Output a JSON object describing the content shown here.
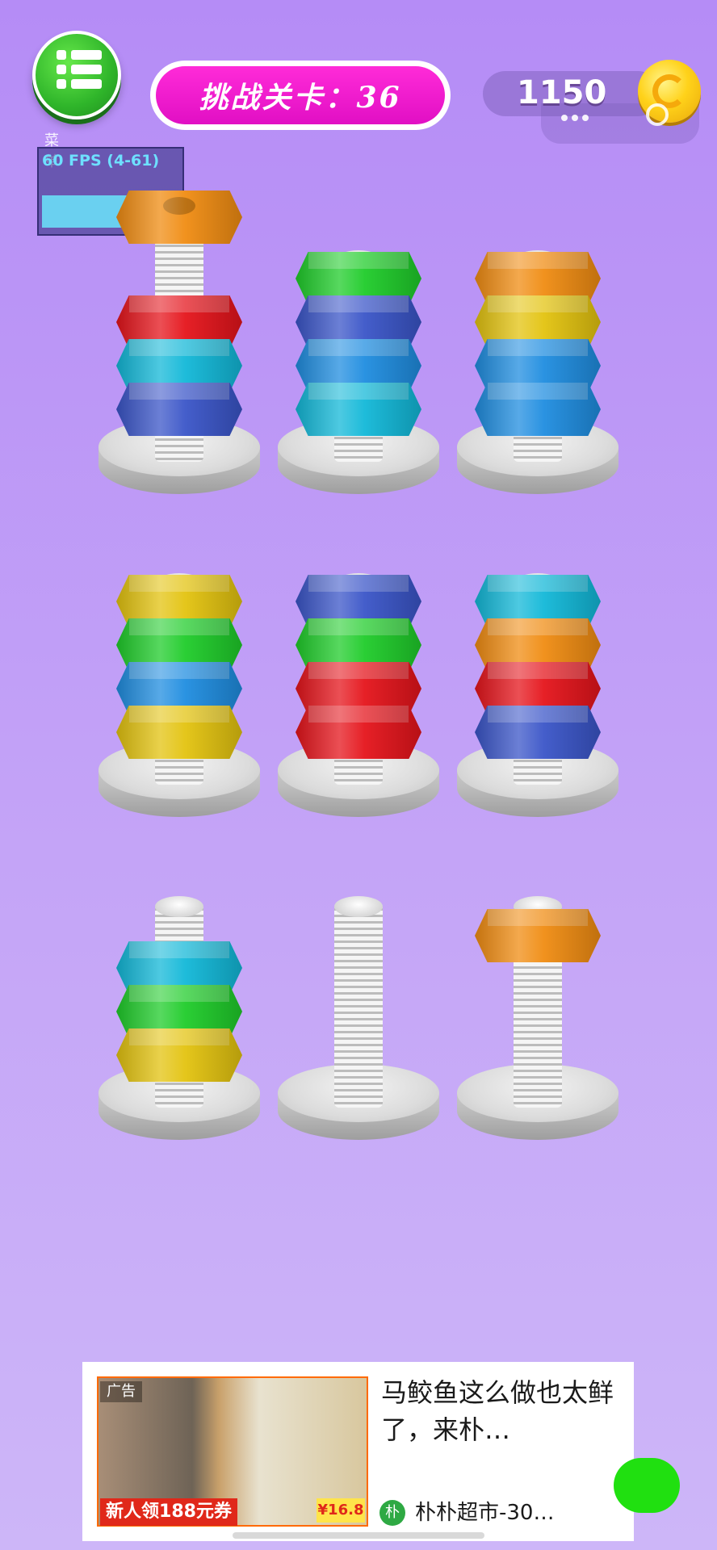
{
  "header": {
    "menu_label": "菜 单",
    "level_label": "挑战关卡：36",
    "coins": "1150"
  },
  "debug": {
    "fps_text": "60 FPS (4-61)"
  },
  "colors": {
    "red": "#e5141b",
    "blue": "#3a55c8",
    "cyan": "#12b8d8",
    "green": "#1fcc2a",
    "yellow": "#e3c30f",
    "orange": "#f08c12",
    "skyblue": "#1f8de0"
  },
  "bolts": [
    {
      "id": 1,
      "nuts_bottom_to_top": [
        "blue",
        "cyan",
        "red"
      ],
      "lifted_nut": "orange"
    },
    {
      "id": 2,
      "nuts_bottom_to_top": [
        "cyan",
        "skyblue",
        "blue",
        "green"
      ]
    },
    {
      "id": 3,
      "nuts_bottom_to_top": [
        "skyblue",
        "skyblue",
        "yellow",
        "orange"
      ]
    },
    {
      "id": 4,
      "nuts_bottom_to_top": [
        "yellow",
        "skyblue",
        "green",
        "yellow"
      ]
    },
    {
      "id": 5,
      "nuts_bottom_to_top": [
        "red",
        "red",
        "green",
        "blue"
      ]
    },
    {
      "id": 6,
      "nuts_bottom_to_top": [
        "blue",
        "red",
        "orange",
        "cyan"
      ]
    },
    {
      "id": 7,
      "nuts_bottom_to_top": [
        "yellow",
        "green",
        "cyan"
      ]
    },
    {
      "id": 8,
      "nuts_bottom_to_top": []
    },
    {
      "id": 9,
      "nuts_bottom_to_top": [
        "orange"
      ]
    }
  ],
  "ad": {
    "badge": "广告",
    "title": "马鲛鱼这么做也太鲜了，来朴…",
    "promo": "新人领188元券",
    "price": "¥16.8",
    "brand_icon": "朴",
    "brand": "朴朴超市-30…"
  }
}
